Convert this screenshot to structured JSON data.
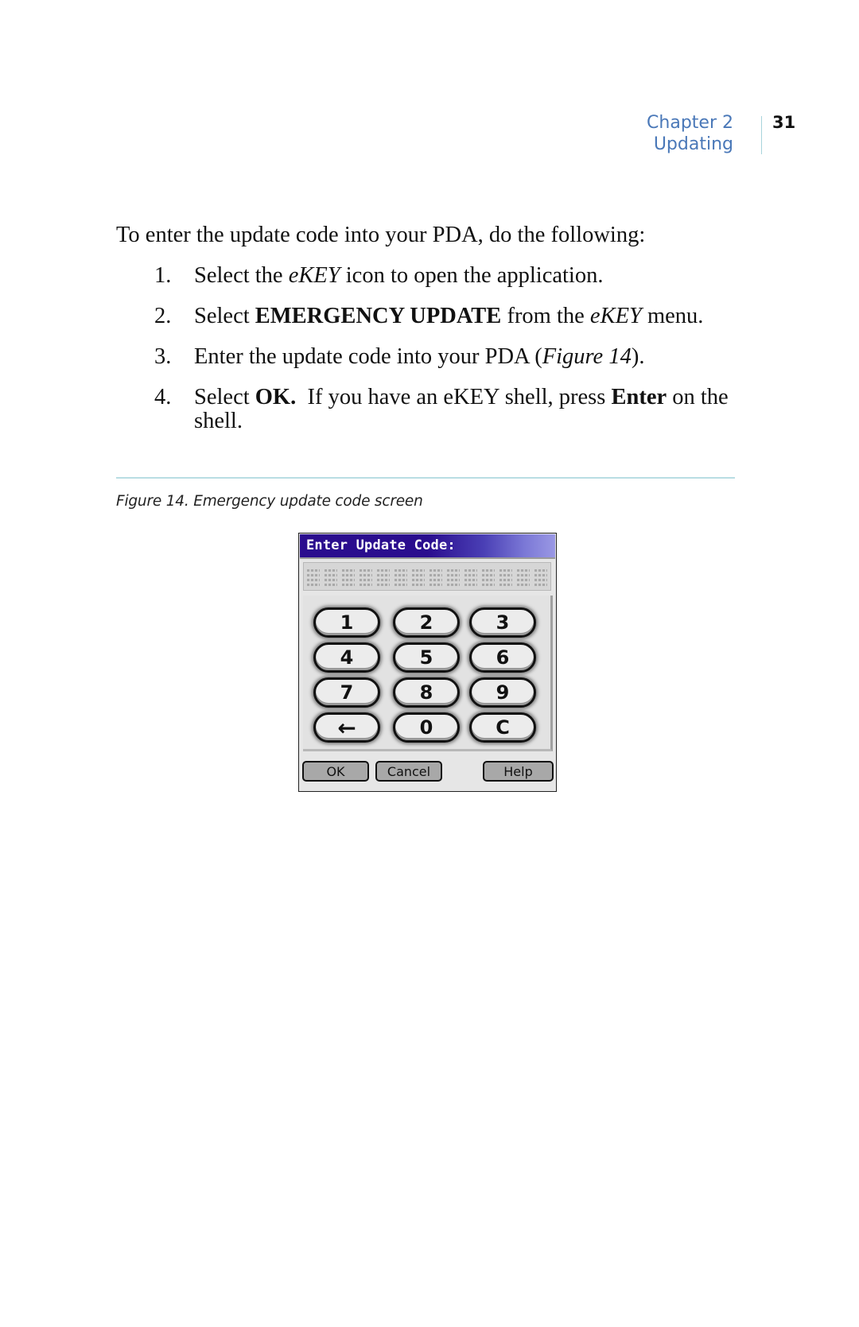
{
  "header": {
    "chapter": "Chapter 2",
    "section": "Updating",
    "page_number": "31"
  },
  "body": {
    "intro": "To enter the update code into your PDA, do the following:",
    "steps": [
      {
        "number": "1.",
        "parts": [
          {
            "text": "Select the ",
            "style": "normal"
          },
          {
            "text": "eKEY",
            "style": "italic"
          },
          {
            "text": " icon to open the application.",
            "style": "normal"
          }
        ]
      },
      {
        "number": "2.",
        "parts": [
          {
            "text": "Select ",
            "style": "normal"
          },
          {
            "text": "EMERGENCY UPDATE",
            "style": "bold"
          },
          {
            "text": " from the ",
            "style": "normal"
          },
          {
            "text": "eKEY",
            "style": "italic"
          },
          {
            "text": " menu.",
            "style": "normal"
          }
        ]
      },
      {
        "number": "3.",
        "parts": [
          {
            "text": "Enter the update code into your PDA (",
            "style": "normal"
          },
          {
            "text": "Figure 14",
            "style": "italic"
          },
          {
            "text": ").",
            "style": "normal"
          }
        ]
      },
      {
        "number": "4.",
        "parts": [
          {
            "text": "Select ",
            "style": "normal"
          },
          {
            "text": "OK.",
            "style": "bold"
          },
          {
            "text": "  If you have an eKEY shell, press ",
            "style": "normal"
          },
          {
            "text": "Enter",
            "style": "bold"
          },
          {
            "text": " on the shell.",
            "style": "normal"
          }
        ]
      }
    ]
  },
  "figure": {
    "caption": "Figure 14.  Emergency update code screen",
    "screen": {
      "title": "Enter Update Code:",
      "code_value": "",
      "code_cells": 14,
      "keys": [
        {
          "label": "1",
          "name": "key-1"
        },
        {
          "label": "2",
          "name": "key-2"
        },
        {
          "label": "3",
          "name": "key-3"
        },
        {
          "label": "4",
          "name": "key-4"
        },
        {
          "label": "5",
          "name": "key-5"
        },
        {
          "label": "6",
          "name": "key-6"
        },
        {
          "label": "7",
          "name": "key-7"
        },
        {
          "label": "8",
          "name": "key-8"
        },
        {
          "label": "9",
          "name": "key-9"
        },
        {
          "label": "←",
          "name": "key-backspace",
          "icon": "left-arrow-icon"
        },
        {
          "label": "0",
          "name": "key-0"
        },
        {
          "label": "C",
          "name": "key-clear"
        }
      ],
      "buttons": {
        "ok": "OK",
        "cancel": "Cancel",
        "help": "Help"
      }
    }
  },
  "colors": {
    "header_text": "#4a78b8",
    "rule": "#b9dde3",
    "title_bar": "#2a0d8e"
  }
}
